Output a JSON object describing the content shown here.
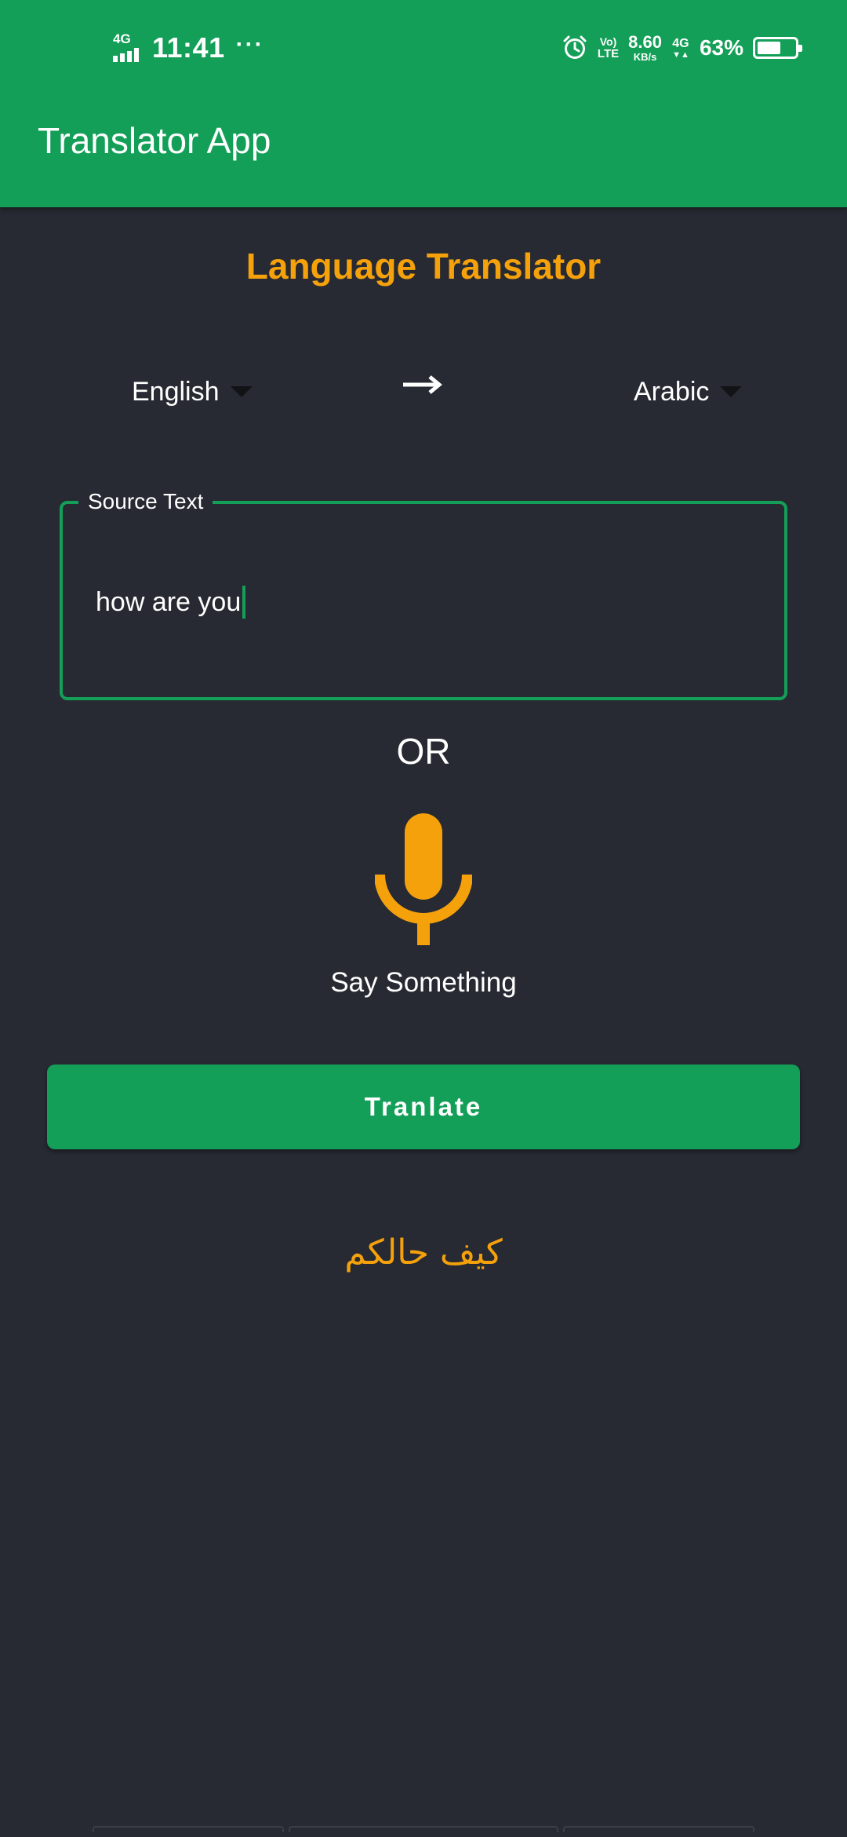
{
  "status_bar": {
    "network_label": "4G",
    "time": "11:41",
    "overflow_dots": "···",
    "volte_top": "Vo)",
    "volte_bottom": "LTE",
    "speed_value": "8.60",
    "speed_unit": "KB/s",
    "network2_label": "4G",
    "battery_percent": "63%",
    "battery_level": 0.63
  },
  "app_bar": {
    "title": "Translator App"
  },
  "main": {
    "title": "Language Translator",
    "source_language": "English",
    "target_language": "Arabic",
    "source_field": {
      "label": "Source Text",
      "value": "how are you"
    },
    "or_text": "OR",
    "mic_label": "Say Something",
    "translate_button": "Tranlate",
    "result": "كيف حالكم"
  },
  "colors": {
    "primary": "#139f57",
    "accent": "#f5a10c",
    "background": "#272a32",
    "text": "#ffffff"
  },
  "icons": {
    "alarm": "alarm-clock-icon",
    "swap": "arrow-right-icon",
    "mic": "microphone-icon",
    "dropdown": "caret-down-icon"
  }
}
